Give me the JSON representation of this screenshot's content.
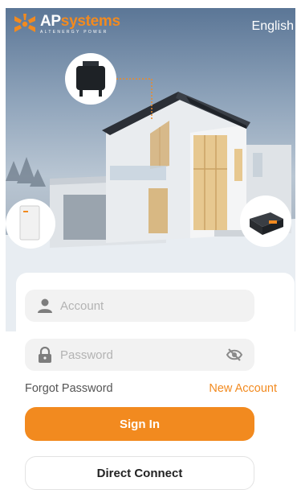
{
  "brand": {
    "name_part1": "AP",
    "name_part2": "systems",
    "tagline": "ALTENERGY POWER"
  },
  "header": {
    "language": "English"
  },
  "login": {
    "account_placeholder": "Account",
    "password_placeholder": "Password",
    "forgot_password": "Forgot Password",
    "new_account": "New Account",
    "sign_in": "Sign In",
    "direct_connect": "Direct Connect"
  },
  "colors": {
    "accent": "#f28a1f",
    "field_bg": "#f2f2f2",
    "text_muted": "#b3b3b3"
  },
  "icons": {
    "account": "person-icon",
    "password": "lock-icon",
    "visibility": "eye-off-icon"
  }
}
